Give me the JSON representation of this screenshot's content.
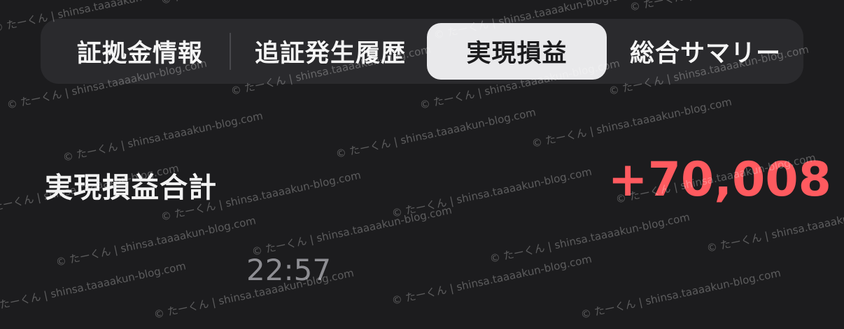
{
  "tabs": [
    {
      "label": "証拠金情報",
      "active": false
    },
    {
      "label": "追証発生履歴",
      "active": false
    },
    {
      "label": "実現損益",
      "active": true
    },
    {
      "label": "総合サマリー",
      "active": false
    }
  ],
  "summary": {
    "label": "実現損益合計",
    "value": "+70,008"
  },
  "timestamp": "22:57",
  "watermark": {
    "text": "© たーくん | shinsa.taaaakun-blog.com"
  },
  "colors": {
    "background": "#1c1c1e",
    "tab_bar": "#2a2a2d",
    "active_tab": "#e9e9eb",
    "positive_value": "#ff5a5f",
    "muted_text": "#8e8e93"
  }
}
